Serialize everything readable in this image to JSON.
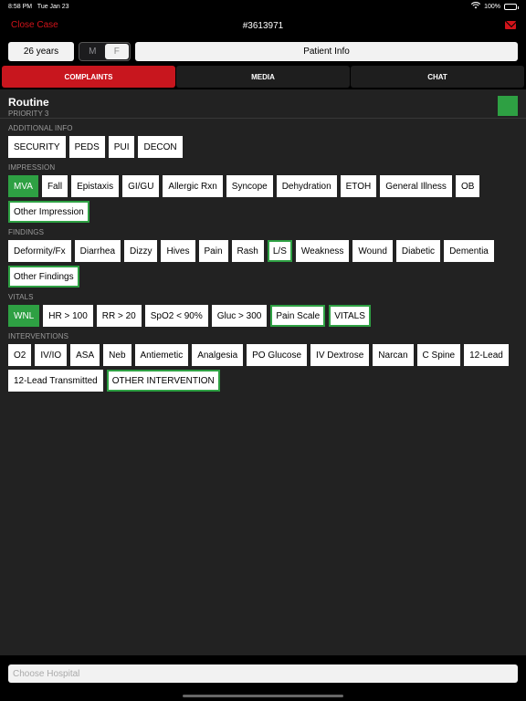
{
  "status": {
    "time": "8:58 PM",
    "date": "Tue Jan 23",
    "battery": "100%"
  },
  "nav": {
    "close_label": "Close Case",
    "title": "#3613971"
  },
  "patient": {
    "age": "26 years",
    "sex_options": [
      "M",
      "F"
    ],
    "sex_selected": "F",
    "info_label": "Patient Info"
  },
  "tabs": [
    "COMPLAINTS",
    "MEDIA",
    "CHAT"
  ],
  "active_tab": "COMPLAINTS",
  "priority": {
    "name": "Routine",
    "sub": "PRIORITY 3",
    "color": "#2ea043"
  },
  "sections": [
    {
      "label": "ADDITIONAL INFO",
      "items": [
        {
          "text": "SECURITY",
          "state": "normal"
        },
        {
          "text": "PEDS",
          "state": "normal"
        },
        {
          "text": "PUI",
          "state": "normal"
        },
        {
          "text": "DECON",
          "state": "normal"
        }
      ]
    },
    {
      "label": "IMPRESSION",
      "items": [
        {
          "text": "MVA",
          "state": "selected"
        },
        {
          "text": "Fall",
          "state": "normal"
        },
        {
          "text": "Epistaxis",
          "state": "normal"
        },
        {
          "text": "GI/GU",
          "state": "normal"
        },
        {
          "text": "Allergic Rxn",
          "state": "normal"
        },
        {
          "text": "Syncope",
          "state": "normal"
        },
        {
          "text": "Dehydration",
          "state": "normal"
        },
        {
          "text": "ETOH",
          "state": "normal"
        },
        {
          "text": "General Illness",
          "state": "normal"
        },
        {
          "text": "OB",
          "state": "normal"
        },
        {
          "text": "Other Impression",
          "state": "outlined"
        }
      ]
    },
    {
      "label": "FINDINGS",
      "items": [
        {
          "text": "Deformity/Fx",
          "state": "normal"
        },
        {
          "text": "Diarrhea",
          "state": "normal"
        },
        {
          "text": "Dizzy",
          "state": "normal"
        },
        {
          "text": "Hives",
          "state": "normal"
        },
        {
          "text": "Pain",
          "state": "normal"
        },
        {
          "text": "Rash",
          "state": "normal"
        },
        {
          "text": "L/S",
          "state": "outlined"
        },
        {
          "text": "Weakness",
          "state": "normal"
        },
        {
          "text": "Wound",
          "state": "normal"
        },
        {
          "text": "Diabetic",
          "state": "normal"
        },
        {
          "text": "Dementia",
          "state": "normal"
        },
        {
          "text": "Other Findings",
          "state": "outlined"
        }
      ]
    },
    {
      "label": "VITALS",
      "items": [
        {
          "text": "WNL",
          "state": "selected"
        },
        {
          "text": "HR > 100",
          "state": "normal"
        },
        {
          "text": "RR > 20",
          "state": "normal"
        },
        {
          "text": "SpO2 < 90%",
          "state": "normal"
        },
        {
          "text": "Gluc > 300",
          "state": "normal"
        },
        {
          "text": "Pain Scale",
          "state": "outlined"
        },
        {
          "text": "VITALS",
          "state": "outlined"
        }
      ]
    },
    {
      "label": "INTERVENTIONS",
      "items": [
        {
          "text": "O2",
          "state": "normal"
        },
        {
          "text": "IV/IO",
          "state": "normal"
        },
        {
          "text": "ASA",
          "state": "normal"
        },
        {
          "text": "Neb",
          "state": "normal"
        },
        {
          "text": "Antiemetic",
          "state": "normal"
        },
        {
          "text": "Analgesia",
          "state": "normal"
        },
        {
          "text": "PO Glucose",
          "state": "normal"
        },
        {
          "text": "IV Dextrose",
          "state": "normal"
        },
        {
          "text": "Narcan",
          "state": "normal"
        },
        {
          "text": "C Spine",
          "state": "normal"
        },
        {
          "text": "12-Lead",
          "state": "normal"
        },
        {
          "text": "12-Lead Transmitted",
          "state": "normal"
        },
        {
          "text": "OTHER INTERVENTION",
          "state": "outlined"
        }
      ]
    }
  ],
  "footer": {
    "hospital_placeholder": "Choose Hospital"
  },
  "icons": {
    "wifi": "wifi-icon",
    "battery": "battery-icon",
    "mail": "mail-icon"
  },
  "colors": {
    "accent_red": "#c8161e",
    "selected_green": "#2ea043"
  }
}
